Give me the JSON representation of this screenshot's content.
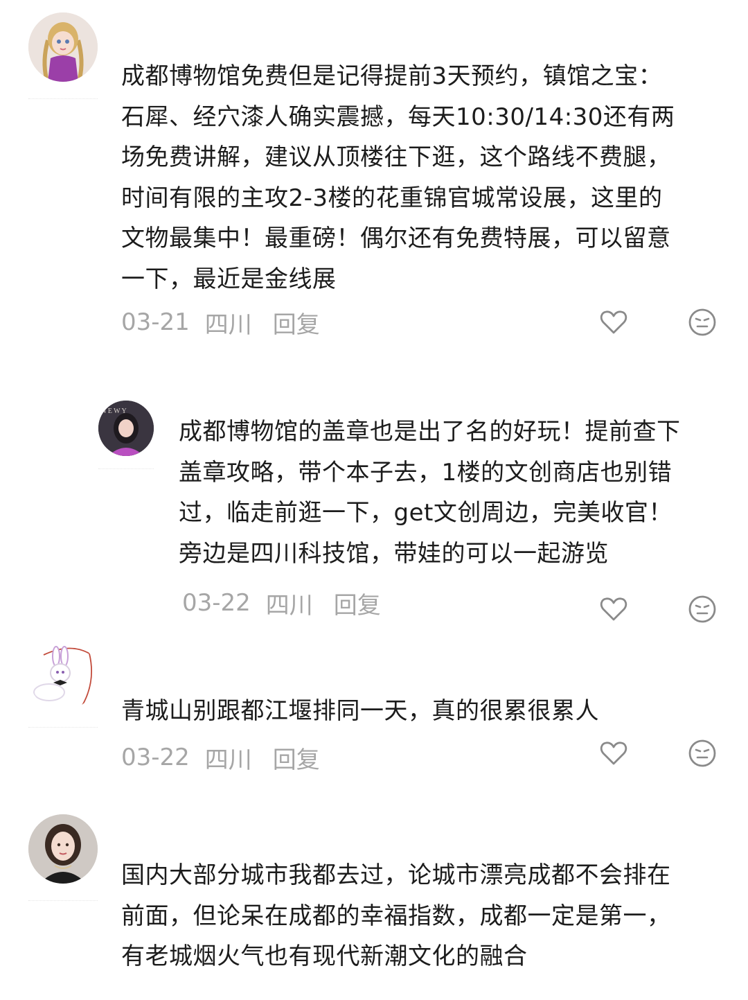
{
  "comments": [
    {
      "lines": [
        "成都博物馆免费但是记得提前3天预约，镇馆之宝：",
        "石犀、经穴漆人确实震撼，每天10:30/14:30还有两",
        "场免费讲解，建议从顶楼往下逛，这个路线不费腿，",
        "时间有限的主攻2-3楼的花重锦官城常设展，这里的",
        "文物最集中！最重磅！偶尔还有免费特展，可以留意",
        "一下，最近是金线展"
      ],
      "date": "03-21",
      "region": "四川",
      "reply_label": "回复"
    },
    {
      "lines": [
        "成都博物馆的盖章也是出了名的好玩！提前查下",
        "盖章攻略，带个本子去，1楼的文创商店也别错",
        "过，临走前逛一下，get文创周边，完美收官！",
        "旁边是四川科技馆，带娃的可以一起游览"
      ],
      "date": "03-22",
      "region": "四川",
      "reply_label": "回复"
    },
    {
      "lines": [
        "青城山别跟都江堰排同一天，真的很累很累人"
      ],
      "date": "03-22",
      "region": "四川",
      "reply_label": "回复"
    },
    {
      "lines": [
        "国内大部分城市我都去过，论城市漂亮成都不会排在",
        "前面，但论呆在成都的幸福指数，成都一定是第一，",
        "有老城烟火气也有现代新潮文化的融合"
      ]
    }
  ],
  "icons": {
    "like": "heart-outline-icon",
    "dislike": "meh-face-icon"
  },
  "colors": {
    "text": "#1c1c1c",
    "meta": "#a6a6a6",
    "icon": "#8a8a8a"
  }
}
